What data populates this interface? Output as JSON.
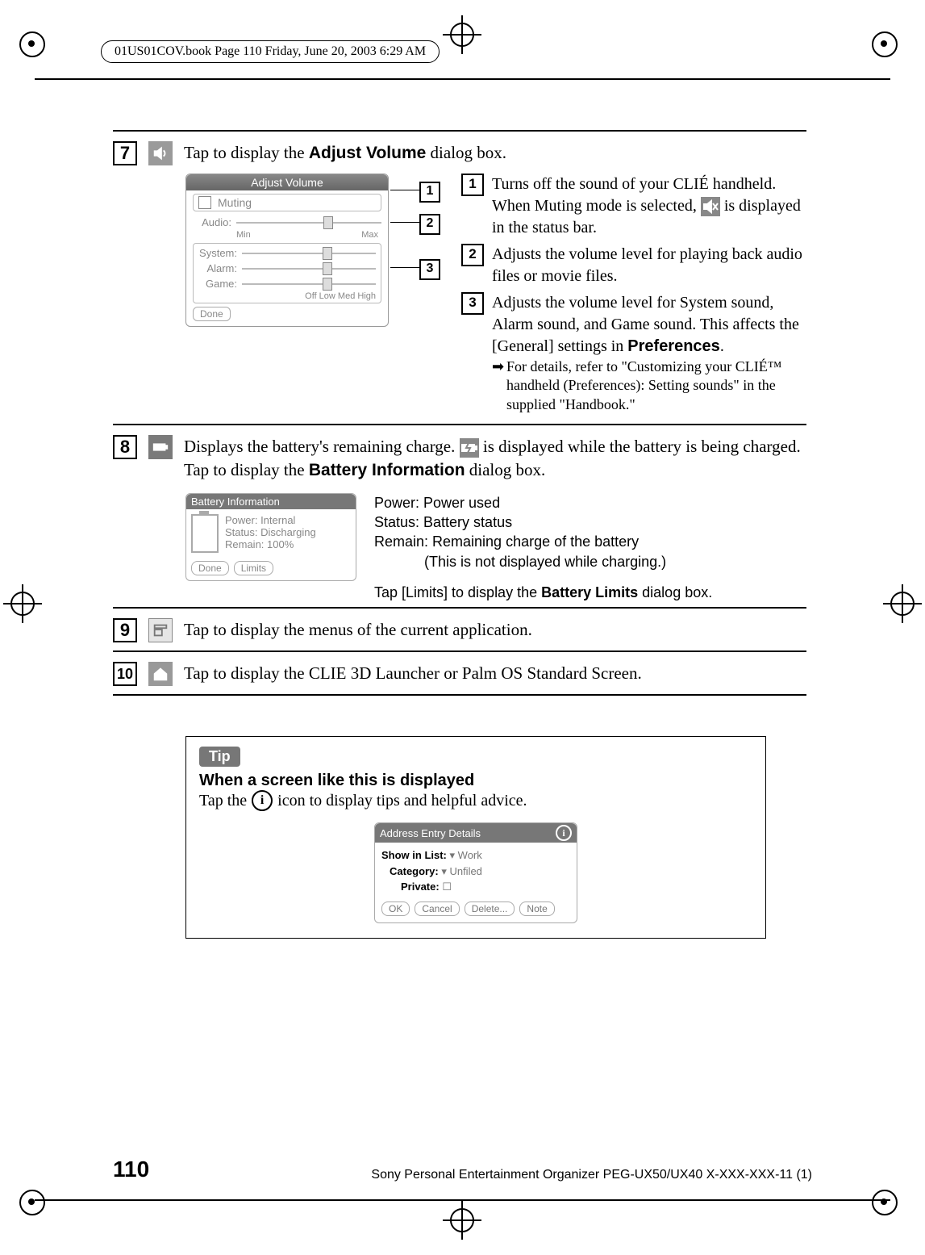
{
  "print_header": "01US01COV.book  Page 110  Friday, June 20, 2003  6:29 AM",
  "page_number": "110",
  "footer": "Sony Personal Entertainment Organizer  PEG-UX50/UX40  X-XXX-XXX-11 (1)",
  "content": {
    "row7": {
      "number": "7",
      "lead_text": "Tap to display the ",
      "adjust_volume_bold": "Adjust Volume",
      "trail_text": " dialog box.",
      "dialog": {
        "title": "Adjust Volume",
        "muting": "Muting",
        "audio": "Audio:",
        "min": "Min",
        "max": "Max",
        "system": "System:",
        "alarm": "Alarm:",
        "game": "Game:",
        "levels": "Off  Low Med High",
        "done": "Done"
      },
      "callouts": {
        "c1": "1",
        "c2": "2",
        "c3": "3"
      },
      "items": {
        "i1": {
          "num": "1",
          "line1": "Turns off the sound of your CLIÉ handheld.",
          "line2a": "When Muting mode is selected, ",
          "line2b": " is displayed in the status bar."
        },
        "i2": {
          "num": "2",
          "text": "Adjusts the volume level for playing back audio files or movie files."
        },
        "i3": {
          "num": "3",
          "line1": "Adjusts the volume level for System sound, Alarm sound, and Game sound. This affects the [General] settings in ",
          "pref": "Preferences",
          "period": ".",
          "note": "For details, refer to \"Customizing your CLIÉ™ handheld (Preferences): Setting sounds\" in the supplied \"Handbook.\""
        }
      }
    },
    "row8": {
      "number": "8",
      "line1a": "Displays the battery's remaining charge. ",
      "line1b": " is displayed while the battery is being charged.",
      "line2a": "Tap to display the ",
      "battery_info_bold": "Battery Information",
      "line2b": " dialog box.",
      "box": {
        "title": "Battery Information",
        "power": "Power: Internal",
        "status": "Status: Discharging",
        "remain": "Remain: 100%",
        "done": "Done",
        "limits": "Limits"
      },
      "right": {
        "l1": "Power: Power used",
        "l2": "Status: Battery status",
        "l3": "Remain: Remaining charge of the battery",
        "l3b": "(This is not displayed while charging.)",
        "l4a": "Tap [Limits] to display the ",
        "l4bold": "Battery Limits",
        "l4b": " dialog box."
      }
    },
    "row9": {
      "number": "9",
      "text": "Tap to display the menus of the current application."
    },
    "row10": {
      "number": "10",
      "text": "Tap to display the CLIE 3D Launcher or Palm OS Standard Screen."
    },
    "tip": {
      "tag": "Tip",
      "title": "When a screen like this is displayed",
      "text_a": "Tap the ",
      "text_b": " icon to display tips and helpful advice.",
      "box": {
        "title": "Address Entry Details",
        "l1_label": "Show in List:",
        "l1_val": "▾ Work",
        "l2_label": "Category:",
        "l2_val": "▾ Unfiled",
        "l3_label": "Private:",
        "l3_val": "☐",
        "btns": {
          "ok": "OK",
          "cancel": "Cancel",
          "delete": "Delete...",
          "note": "Note"
        }
      }
    }
  }
}
